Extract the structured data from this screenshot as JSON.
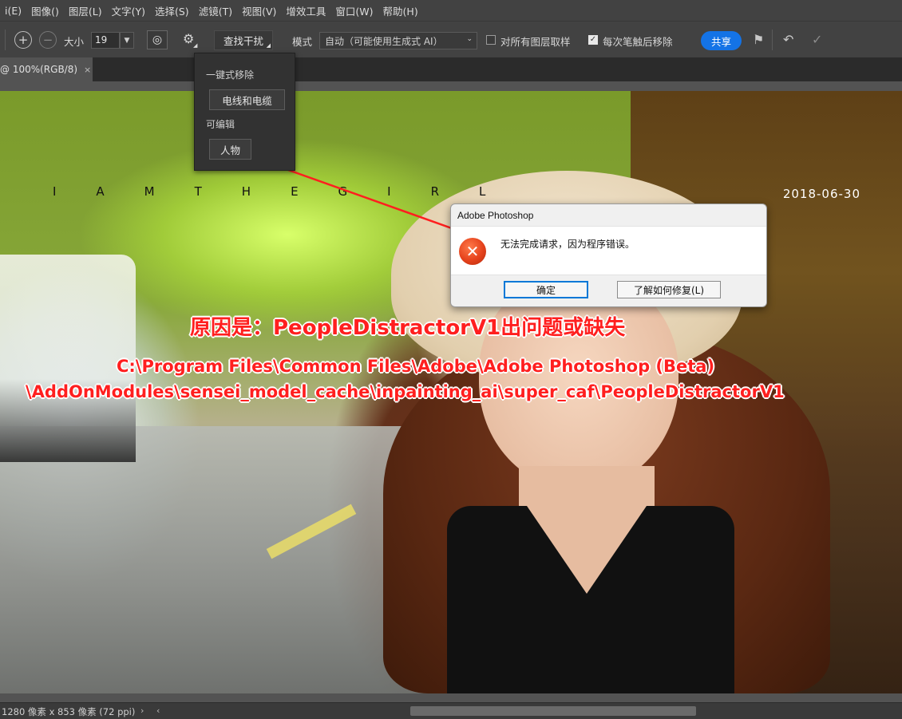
{
  "menubar": {
    "items": [
      "i(E)",
      "图像()",
      "图层(L)",
      "文字(Y)",
      "选择(S)",
      "滤镜(T)",
      "视图(V)",
      "增效工具",
      "窗口(W)",
      "帮助(H)"
    ]
  },
  "options": {
    "add_icon": "plus-circle-icon",
    "subtract_icon": "minus-circle-icon",
    "size_label": "大小",
    "size_value": "19",
    "find_button": "查找干扰",
    "mode_label": "模式",
    "mode_value": "自动（可能使用生成式 AI）",
    "sample_all_label": "对所有图层取样",
    "sample_all_checked": false,
    "remove_after_label": "每次笔触后移除",
    "remove_after_checked": true,
    "share_label": "共享",
    "colors": {
      "accent": "#1473e6"
    }
  },
  "popup": {
    "section1": "一键式移除",
    "btn_wires": "电线和电缆",
    "section2": "可编辑",
    "btn_people": "人物"
  },
  "tab": {
    "label": "@ 100%(RGB/8)",
    "close": "×"
  },
  "photo": {
    "caption": "IAMTHEGIRL",
    "date": "2018-06-30"
  },
  "annotations": {
    "reason": "原因是：PeopleDistractorV1出问题或缺失",
    "path_line1": "C:\\Program Files\\Common Files\\Adobe\\Adobe Photoshop (Beta)",
    "path_line2": "\\AddOnModules\\sensei_model_cache\\inpainting_ai\\super_caf\\PeopleDistractorV1",
    "color": "#ff1f1f"
  },
  "dialog": {
    "title": "Adobe Photoshop",
    "message": "无法完成请求，因为程序错误。",
    "ok": "确定",
    "help": "了解如何修复(L)"
  },
  "status": {
    "info": "1280 像素 x 853 像素 (72 ppi)",
    "arrow_right": "›",
    "arrow_left": "‹"
  }
}
